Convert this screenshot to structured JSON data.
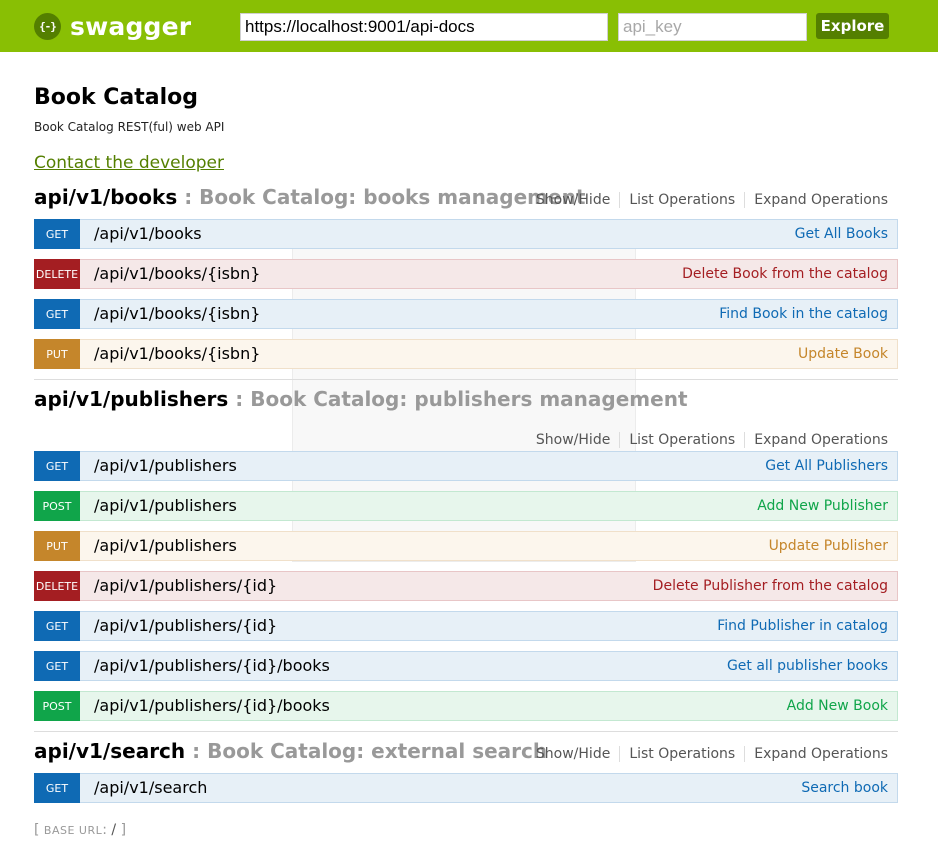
{
  "header": {
    "logo_icon": "{-}",
    "logo_text": "swagger",
    "url_value": "https://localhost:9001/api-docs",
    "api_key_placeholder": "api_key",
    "explore_label": "Explore",
    "colors": {
      "bar": "#89bf04",
      "button": "#547f00"
    }
  },
  "info": {
    "title": "Book Catalog",
    "description": "Book Catalog REST(ful) web API",
    "contact": "Contact the developer"
  },
  "links": {
    "show_hide": "Show/Hide",
    "list": "List Operations",
    "expand": "Expand Operations"
  },
  "resources": [
    {
      "name": "api/v1/books",
      "sep": " : ",
      "description": "Book Catalog: books management",
      "operations": [
        {
          "method": "GET",
          "path": "/api/v1/books",
          "summary": "Get All Books"
        },
        {
          "method": "DELETE",
          "path": "/api/v1/books/{isbn}",
          "summary": "Delete Book from the catalog"
        },
        {
          "method": "GET",
          "path": "/api/v1/books/{isbn}",
          "summary": "Find Book in the catalog"
        },
        {
          "method": "PUT",
          "path": "/api/v1/books/{isbn}",
          "summary": "Update Book"
        }
      ]
    },
    {
      "name": "api/v1/publishers",
      "sep": " : ",
      "description": "Book Catalog: publishers management",
      "operations": [
        {
          "method": "GET",
          "path": "/api/v1/publishers",
          "summary": "Get All Publishers"
        },
        {
          "method": "POST",
          "path": "/api/v1/publishers",
          "summary": "Add New Publisher"
        },
        {
          "method": "PUT",
          "path": "/api/v1/publishers",
          "summary": "Update Publisher"
        },
        {
          "method": "DELETE",
          "path": "/api/v1/publishers/{id}",
          "summary": "Delete Publisher from the catalog"
        },
        {
          "method": "GET",
          "path": "/api/v1/publishers/{id}",
          "summary": "Find Publisher in catalog"
        },
        {
          "method": "GET",
          "path": "/api/v1/publishers/{id}/books",
          "summary": "Get all publisher books"
        },
        {
          "method": "POST",
          "path": "/api/v1/publishers/{id}/books",
          "summary": "Add New Book"
        }
      ]
    },
    {
      "name": "api/v1/search",
      "sep": " : ",
      "description": "Book Catalog: external search",
      "operations": [
        {
          "method": "GET",
          "path": "/api/v1/search",
          "summary": "Search book"
        }
      ]
    }
  ],
  "footer": {
    "open": "[ ",
    "label": "BASE URL",
    "colon": ": ",
    "value": "/",
    "close": " ]"
  },
  "method_colors": {
    "GET": "#0f6ab4",
    "DELETE": "#a41e22",
    "PUT": "#c5862b",
    "POST": "#10a54a"
  }
}
